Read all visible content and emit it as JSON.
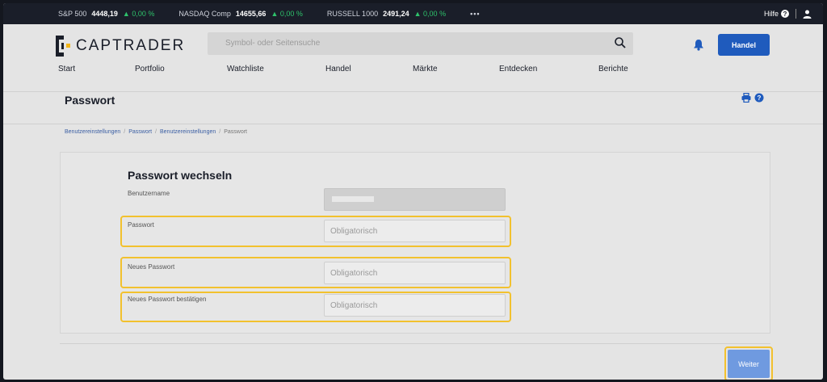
{
  "ticker": {
    "items": [
      {
        "name": "S&P 500",
        "value": "4448,19",
        "change": "▲ 0,00 %"
      },
      {
        "name": "NASDAQ Comp",
        "value": "14655,66",
        "change": "▲ 0,00 %"
      },
      {
        "name": "RUSSELL 1000",
        "value": "2491,24",
        "change": "▲ 0,00 %"
      }
    ],
    "more": "•••",
    "help_label": "Hilfe",
    "up_color": "#2ec26b"
  },
  "header": {
    "logo_text": "CAPTRADER",
    "search_placeholder": "Symbol- oder Seitensuche",
    "trade_button": "Handel",
    "brand_color": "#1f5bbd"
  },
  "nav": {
    "items": [
      "Start",
      "Portfolio",
      "Watchliste",
      "Handel",
      "Märkte",
      "Entdecken",
      "Berichte"
    ]
  },
  "page": {
    "title": "Passwort",
    "breadcrumb": [
      "Benutzereinstellungen",
      "Passwort",
      "Benutzereinstellungen",
      "Passwort"
    ]
  },
  "form": {
    "title": "Passwort wechseln",
    "username_label": "Benutzername",
    "password_label": "Passwort",
    "new_password_label": "Neues Passwort",
    "confirm_password_label": "Neues Passwort bestätigen",
    "placeholder": "Obligatorisch",
    "highlight_color": "#f2c12e"
  },
  "footer": {
    "next_button": "Weiter"
  }
}
